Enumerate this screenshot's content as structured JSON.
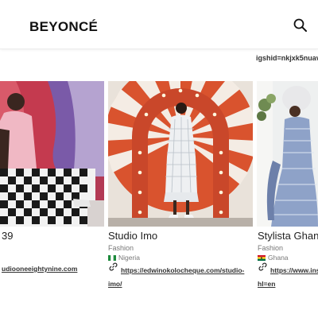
{
  "header": {
    "logo": "BEYONCÉ",
    "search_icon": "search-icon"
  },
  "previous_link_tail": "igshid=nkjxk5nuav",
  "cards": [
    {
      "title": "39",
      "link_line1": "udiooneeightynine.com"
    },
    {
      "title": "Studio Imo",
      "category": "Fashion",
      "country": "Nigeria",
      "link_line1": "https://edwinokolocheque.com/studio-",
      "link_line2": "imo/"
    },
    {
      "title": "Stylista Ghan",
      "category": "Fashion",
      "country": "Ghana",
      "link_line1": "https://www.ins",
      "link_line2": "hl=en"
    }
  ],
  "colors": {
    "nigeria_green": "#1d8a3c",
    "ghana_red": "#ce1126",
    "ghana_gold": "#fcd116",
    "ghana_green": "#006b3f"
  }
}
